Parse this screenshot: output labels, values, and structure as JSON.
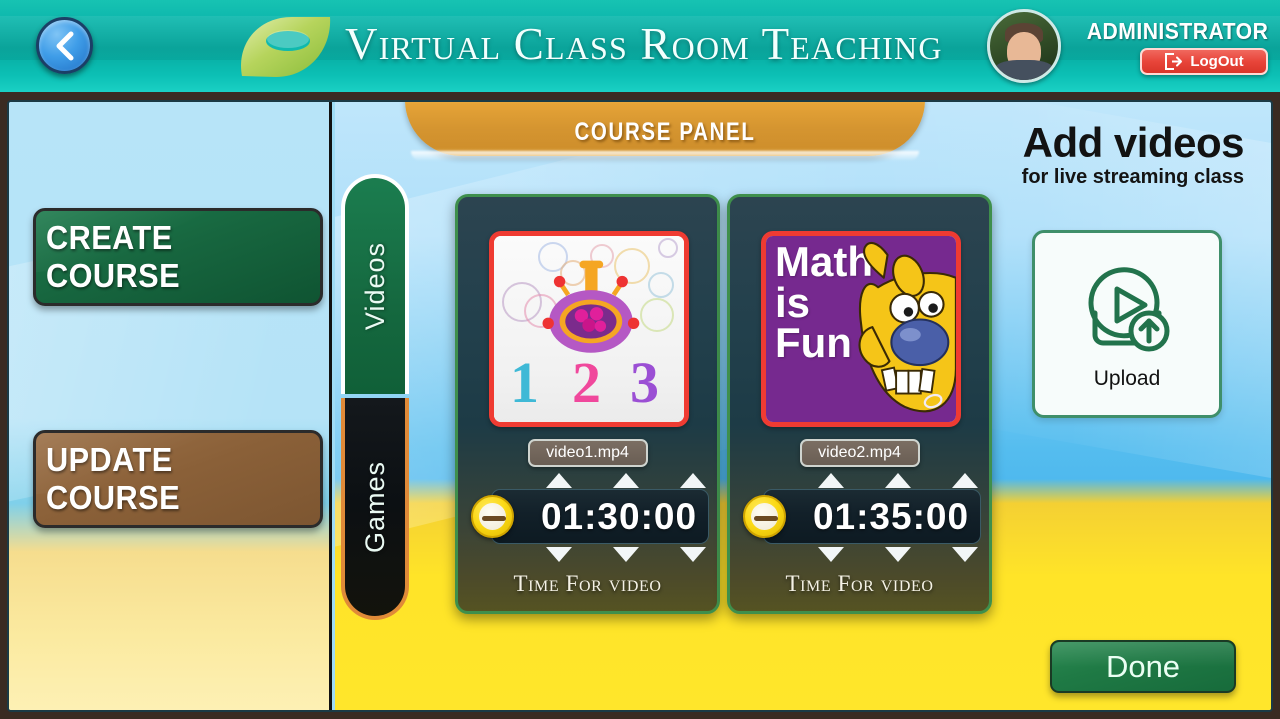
{
  "header": {
    "back_icon": "chevron-left-icon",
    "logo_icon": "leaf-logo-icon",
    "title": "Virtual Class Room Teaching",
    "admin_name": "ADMINISTRATOR",
    "logout_label": "LogOut",
    "logout_icon": "logout-arrow-icon",
    "avatar_alt": "administrator-avatar"
  },
  "sidebar": {
    "buttons": [
      {
        "label": "CREATE COURSE",
        "color": "#17663f"
      },
      {
        "label": "UPDATE COURSE",
        "color": "#8a6038"
      }
    ]
  },
  "panel": {
    "tab_title": "COURSE  PANEL",
    "vertical_tabs": [
      {
        "label": "Videos",
        "active": true,
        "color": "#15683f"
      },
      {
        "label": "Games",
        "active": false,
        "color": "#0c1013"
      }
    ]
  },
  "videos": [
    {
      "filename": "video1.mp4",
      "time": "01:30:00",
      "caption": "Time For video",
      "thumb_alt": "numbers-123-bubbles-thumbnail",
      "clock_icon": "clock-icon"
    },
    {
      "filename": "video2.mp4",
      "time": "01:35:00",
      "caption": "Time For video",
      "thumb_alt": "math-is-fun-dog-thumbnail",
      "thumb_text_line1": "Math",
      "thumb_text_line2": "is",
      "thumb_text_line3": "Fun",
      "clock_icon": "clock-icon"
    }
  ],
  "right": {
    "title": "Add videos",
    "subtitle": "for live streaming class",
    "upload_label": "Upload",
    "upload_icon": "video-upload-icon",
    "done_label": "Done"
  },
  "colors": {
    "header_teal": "#0fb9ae",
    "accent_green": "#17663f",
    "accent_brown": "#8a6038",
    "accent_orange": "#d59530",
    "logout_red": "#e8453a",
    "sand_yellow": "#ffe62b",
    "sky_blue": "#55bdef"
  }
}
